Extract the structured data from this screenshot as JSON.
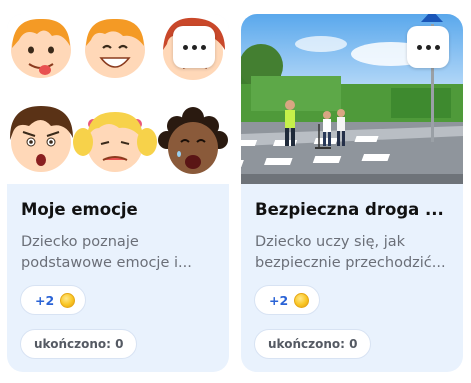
{
  "cards": [
    {
      "title": "Moje emocje",
      "description": "Dziecko poznaje podstawowe emocje i...",
      "points": "+2",
      "points_icon": "coin-icon",
      "status": "ukończono: 0",
      "more_icon": "more-dots-icon"
    },
    {
      "title": "Bezpieczna droga ...",
      "description": "Dziecko uczy się, jak bezpiecznie przechodzić...",
      "points": "+2",
      "points_icon": "coin-icon",
      "status": "ukończono: 0",
      "more_icon": "more-dots-icon"
    }
  ],
  "colors": {
    "card_background": "#e9f2fd",
    "points_text": "#2a63d6",
    "coin": "#f9c623"
  }
}
